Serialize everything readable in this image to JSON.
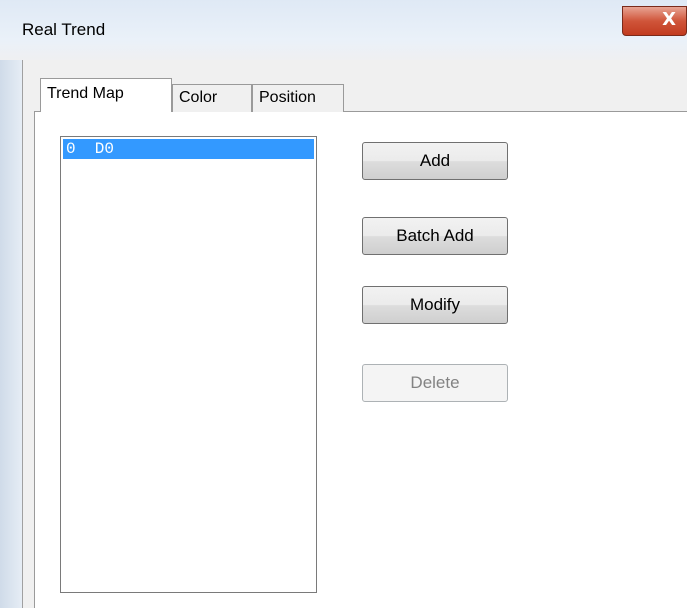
{
  "window": {
    "title": "Real Trend",
    "close_glyph": "X"
  },
  "tabs": [
    {
      "label": "Trend Map",
      "active": true
    },
    {
      "label": "Color",
      "active": false
    },
    {
      "label": "Position",
      "active": false
    }
  ],
  "list": {
    "items": [
      "0  D0"
    ],
    "selected_index": 0
  },
  "buttons": {
    "add": "Add",
    "batch_add": "Batch Add",
    "modify": "Modify",
    "delete": "Delete"
  },
  "colors": {
    "selection": "#3399ff",
    "close_button": "#c94a2e"
  }
}
